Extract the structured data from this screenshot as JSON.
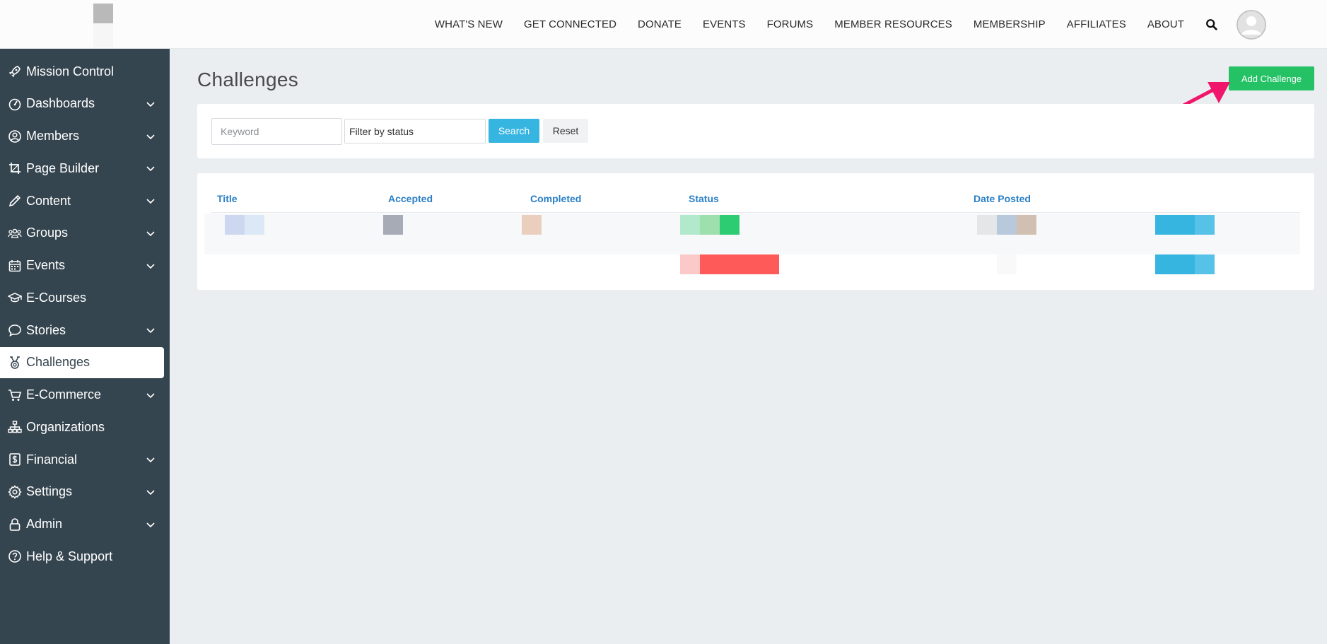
{
  "topnav": {
    "items": [
      "WHAT'S NEW",
      "GET CONNECTED",
      "DONATE",
      "EVENTS",
      "FORUMS",
      "MEMBER RESOURCES",
      "MEMBERSHIP",
      "AFFILIATES",
      "ABOUT"
    ],
    "search_icon": "search-icon",
    "avatar_icon": "user-avatar-icon"
  },
  "sidebar": {
    "items": [
      {
        "label": "Mission Control",
        "icon": "rocket-icon",
        "expandable": false
      },
      {
        "label": "Dashboards",
        "icon": "gauge-icon",
        "expandable": true
      },
      {
        "label": "Members",
        "icon": "user-circle-icon",
        "expandable": true
      },
      {
        "label": "Page Builder",
        "icon": "crop-icon",
        "expandable": true
      },
      {
        "label": "Content",
        "icon": "pencil-icon",
        "expandable": true
      },
      {
        "label": "Groups",
        "icon": "users-icon",
        "expandable": true
      },
      {
        "label": "Events",
        "icon": "calendar-icon",
        "expandable": true
      },
      {
        "label": "E-Courses",
        "icon": "graduation-cap-icon",
        "expandable": false
      },
      {
        "label": "Stories",
        "icon": "speech-bubble-icon",
        "expandable": true
      },
      {
        "label": "Challenges",
        "icon": "medal-icon",
        "expandable": false,
        "active": true
      },
      {
        "label": "E-Commerce",
        "icon": "cart-icon",
        "expandable": true
      },
      {
        "label": "Organizations",
        "icon": "sitemap-icon",
        "expandable": false
      },
      {
        "label": "Financial",
        "icon": "dollar-icon",
        "expandable": true
      },
      {
        "label": "Settings",
        "icon": "gear-icon",
        "expandable": true
      },
      {
        "label": "Admin",
        "icon": "lock-icon",
        "expandable": true
      },
      {
        "label": "Help & Support",
        "icon": "question-circle-icon",
        "expandable": false
      }
    ]
  },
  "main": {
    "title": "Challenges",
    "add_button": "Add Challenge",
    "filters": {
      "keyword_placeholder": "Keyword",
      "status_value": "Filter by status",
      "search_label": "Search",
      "reset_label": "Reset"
    },
    "table": {
      "columns": [
        "Title",
        "Accepted",
        "Completed",
        "Status",
        "Date Posted"
      ]
    }
  },
  "colors": {
    "sidebar_bg": "#35454f",
    "accent_green": "#24c165",
    "accent_blue": "#36b5e0",
    "link_blue": "#2a7fc6",
    "status_red": "#ff5a5a",
    "annotation_arrow": "#f0166c"
  }
}
